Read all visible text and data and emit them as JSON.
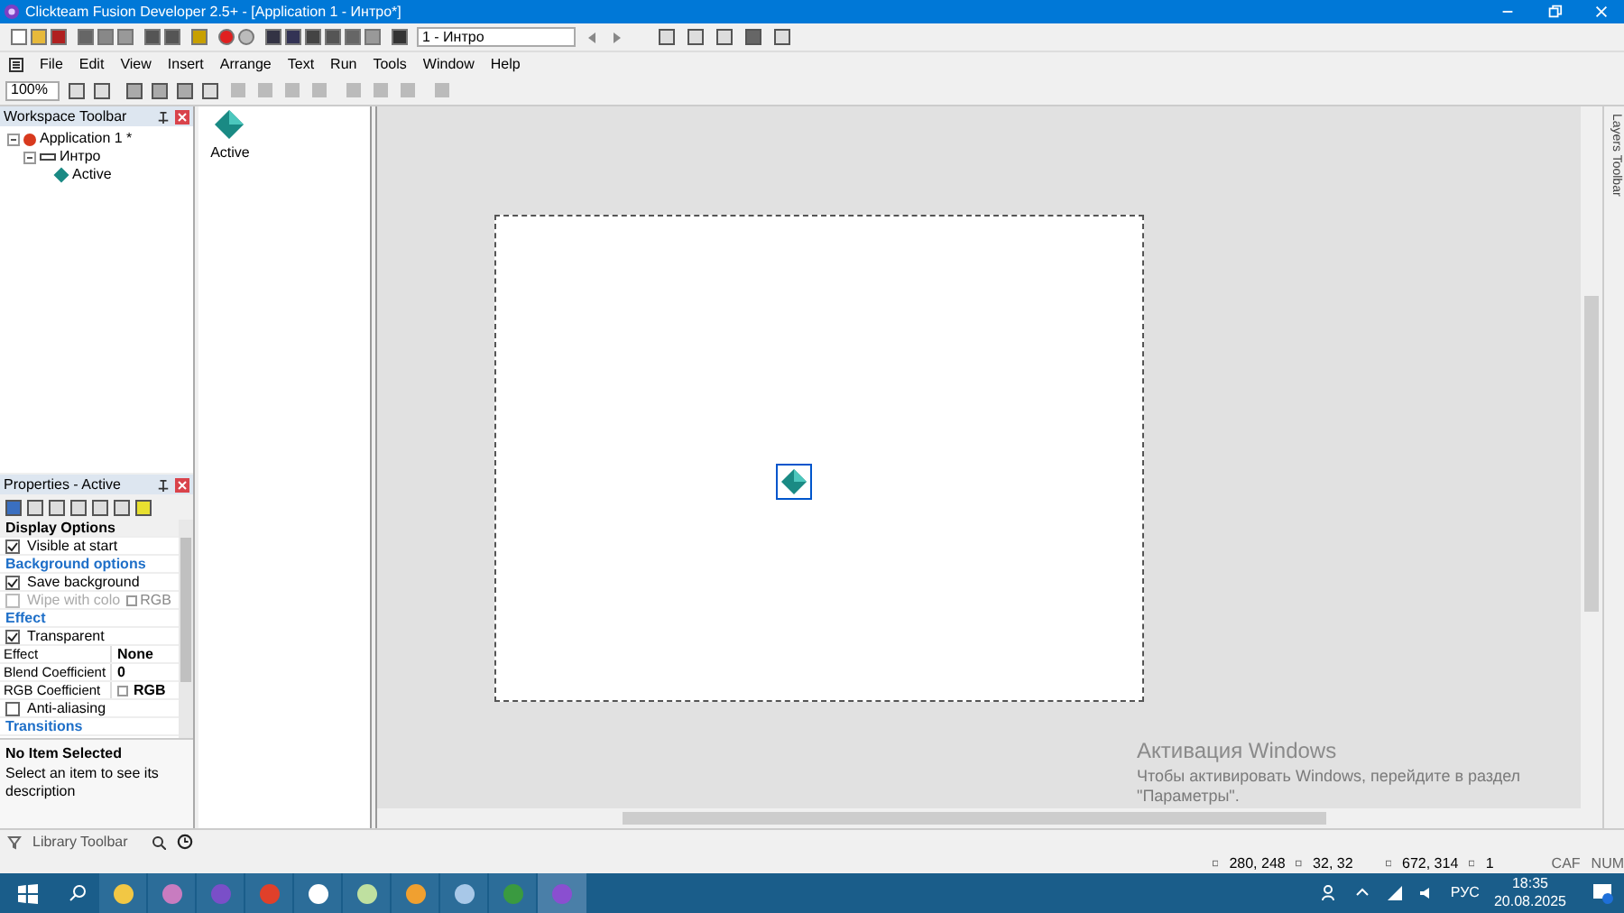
{
  "window": {
    "title": "Clickteam Fusion Developer 2.5+ - [Application 1 - Интро*]"
  },
  "toolbar": {
    "frame_select": "1 - Интро"
  },
  "menu": [
    {
      "label": "File"
    },
    {
      "label": "Edit"
    },
    {
      "label": "View"
    },
    {
      "label": "Insert"
    },
    {
      "label": "Arrange"
    },
    {
      "label": "Text"
    },
    {
      "label": "Run"
    },
    {
      "label": "Tools"
    },
    {
      "label": "Window"
    },
    {
      "label": "Help"
    }
  ],
  "zoom_select": "100%",
  "workspace": {
    "title": "Workspace Toolbar",
    "tree": [
      {
        "label": "Application 1 *",
        "expanded": true,
        "children": [
          {
            "label": "Интро",
            "expanded": true,
            "children": [
              {
                "label": "Active"
              }
            ]
          }
        ]
      }
    ]
  },
  "object_list": [
    {
      "label": "Active"
    }
  ],
  "properties": {
    "title": "Properties - Active",
    "rows": [
      {
        "kind": "header",
        "label": "Display Options"
      },
      {
        "kind": "check",
        "label": "Visible at start",
        "checked": true,
        "disabled": false
      },
      {
        "kind": "section",
        "label": "Background options"
      },
      {
        "kind": "check",
        "label": "Save background",
        "checked": true,
        "disabled": false
      },
      {
        "kind": "check",
        "label": "Wipe with colo",
        "checked": false,
        "disabled": true,
        "value": "RGB"
      },
      {
        "kind": "section",
        "label": "Effect"
      },
      {
        "kind": "check",
        "label": "Transparent",
        "checked": true,
        "disabled": false
      },
      {
        "kind": "prop",
        "label": "Effect",
        "value": "None"
      },
      {
        "kind": "prop",
        "label": "Blend Coefficient",
        "value": "0"
      },
      {
        "kind": "color",
        "label": "RGB Coefficient",
        "value": "RGB"
      },
      {
        "kind": "check",
        "label": "Anti-aliasing",
        "checked": false,
        "disabled": false
      },
      {
        "kind": "section",
        "label": "Transitions"
      }
    ],
    "description_title": "No Item Selected",
    "description": "Select an item to see its description"
  },
  "library_toolbar": "Library Toolbar",
  "layers_toolbar": "Layers Toolbar",
  "activation": {
    "title": "Активация Windows",
    "text": "Чтобы активировать Windows, перейдите в раздел \"Параметры\"."
  },
  "status_bar": {
    "position": "280, 248",
    "size": "32, 32",
    "mouse": "672, 314",
    "count": "1",
    "caps": "CAF",
    "num": "NUM"
  },
  "taskbar": {
    "language": "РУС",
    "time": "18:35",
    "date": "20.08.2025"
  }
}
